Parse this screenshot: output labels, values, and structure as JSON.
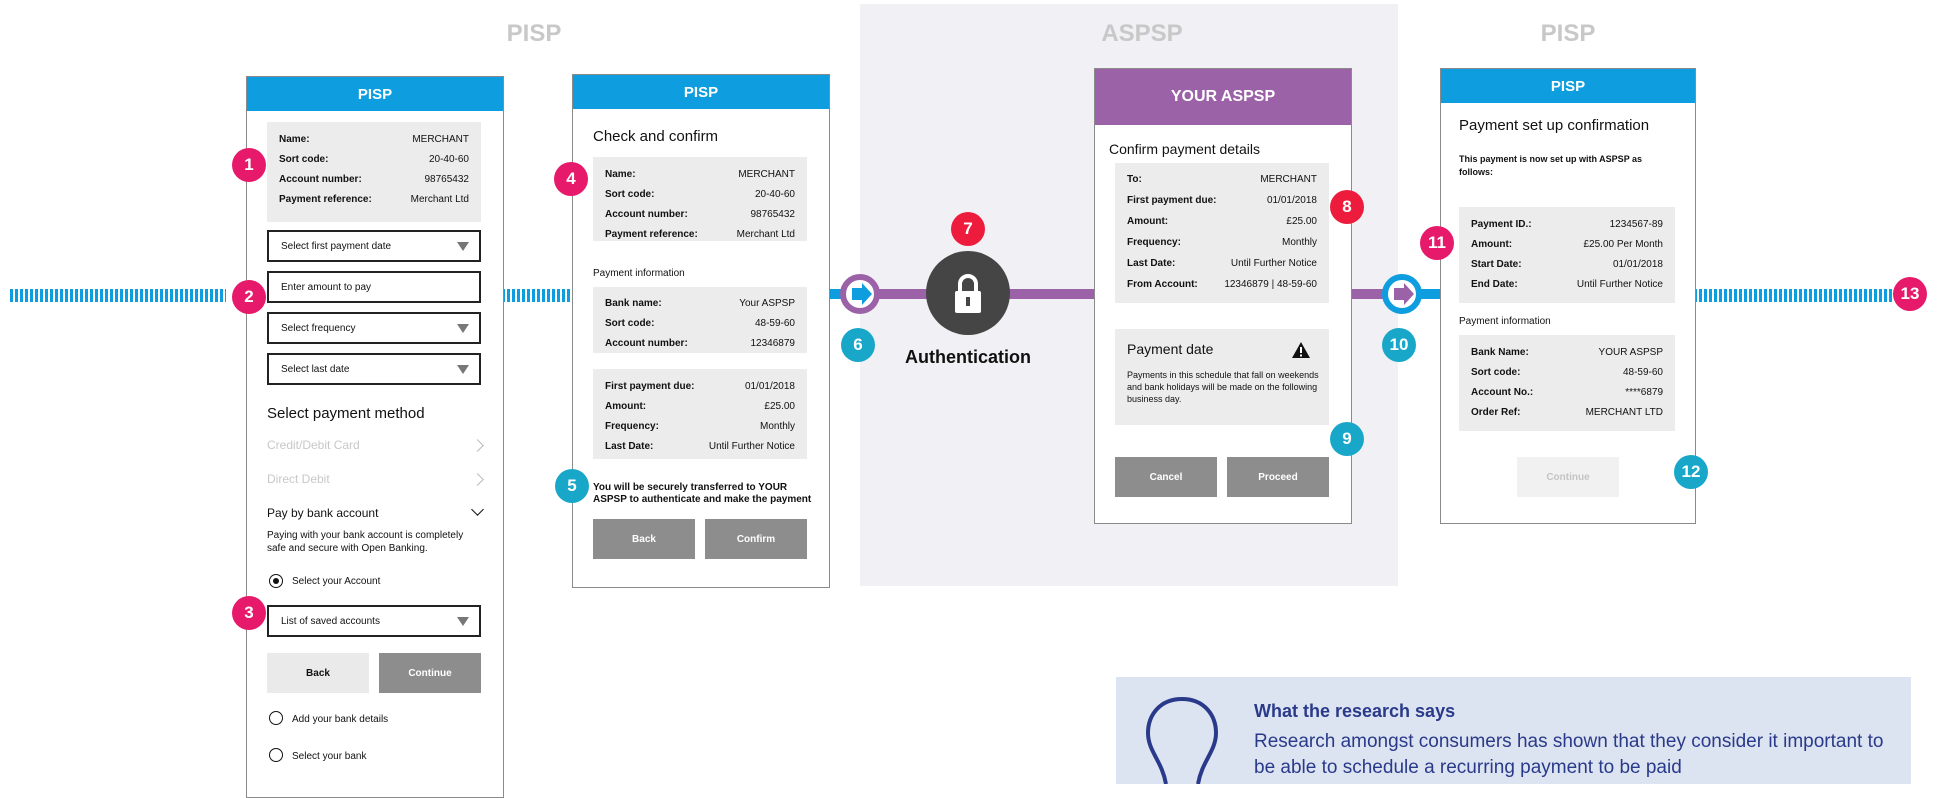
{
  "zones": {
    "pisp_left": "PISP",
    "aspsp": "ASPSP",
    "pisp_right": "PISP"
  },
  "colors": {
    "pisp_blue": "#0e9ee0",
    "aspsp_purple": "#9b62a8",
    "badge_pink": "#e6196b",
    "badge_teal": "#18a7c9",
    "badge_red": "#ee1c3c"
  },
  "screen1": {
    "header": "PISP",
    "details": [
      {
        "k": "Name:",
        "v": "MERCHANT"
      },
      {
        "k": "Sort code:",
        "v": "20-40-60"
      },
      {
        "k": "Account number:",
        "v": "98765432"
      },
      {
        "k": "Payment reference:",
        "v": "Merchant Ltd"
      }
    ],
    "select_first_date": "Select first payment date",
    "amount_placeholder": "Enter amount to pay",
    "select_frequency": "Select frequency",
    "select_last_date": "Select last date",
    "method_heading": "Select payment method",
    "method_card": "Credit/Debit Card",
    "method_dd": "Direct Debit",
    "method_bank": "Pay by bank account",
    "bank_desc": "Paying with your bank account is completely safe and secure with Open Banking.",
    "select_account": "Select your Account",
    "saved_accounts": "List of saved accounts",
    "back": "Back",
    "continue": "Continue",
    "add_bank": "Add your bank details",
    "select_bank": "Select your bank"
  },
  "screen2": {
    "header": "PISP",
    "title": "Check and confirm",
    "details": [
      {
        "k": "Name:",
        "v": "MERCHANT"
      },
      {
        "k": "Sort code:",
        "v": "20-40-60"
      },
      {
        "k": "Account number:",
        "v": "98765432"
      },
      {
        "k": "Payment reference:",
        "v": "Merchant Ltd"
      }
    ],
    "payment_info": "Payment information",
    "bank": [
      {
        "k": "Bank name:",
        "v": "Your ASPSP"
      },
      {
        "k": "Sort code:",
        "v": "48-59-60"
      },
      {
        "k": "Account number:",
        "v": "12346879"
      }
    ],
    "schedule": [
      {
        "k": "First payment due:",
        "v": "01/01/2018"
      },
      {
        "k": "Amount:",
        "v": "£25.00"
      },
      {
        "k": "Frequency:",
        "v": "Monthly"
      },
      {
        "k": "Last Date:",
        "v": "Until Further Notice"
      }
    ],
    "transfer_note": "You will be securely transferred to YOUR ASPSP to authenticate and make the payment",
    "back": "Back",
    "confirm": "Confirm"
  },
  "auth": {
    "label": "Authentication"
  },
  "screen3": {
    "header": "YOUR ASPSP",
    "title": "Confirm payment details",
    "details": [
      {
        "k": "To:",
        "v": "MERCHANT"
      },
      {
        "k": "First payment due:",
        "v": "01/01/2018"
      },
      {
        "k": "Amount:",
        "v": "£25.00"
      },
      {
        "k": "Frequency:",
        "v": "Monthly"
      },
      {
        "k": "Last Date:",
        "v": "Until Further Notice"
      },
      {
        "k": "From Account:",
        "v": "12346879 | 48-59-60"
      }
    ],
    "date_title": "Payment date",
    "date_text": "Payments in this schedule that fall on weekends and bank holidays will be made on the following business day.",
    "cancel": "Cancel",
    "proceed": "Proceed"
  },
  "screen4": {
    "header": "PISP",
    "title": "Payment set up confirmation",
    "subtitle": "This payment is now set up with ASPSP as follows:",
    "details": [
      {
        "k": "Payment ID.:",
        "v": "1234567-89"
      },
      {
        "k": "Amount:",
        "v": "£25.00 Per Month"
      },
      {
        "k": "Start Date:",
        "v": "01/01/2018"
      },
      {
        "k": "End Date:",
        "v": "Until Further Notice"
      }
    ],
    "payment_info": "Payment information",
    "bank": [
      {
        "k": "Bank Name:",
        "v": "YOUR ASPSP"
      },
      {
        "k": "Sort code:",
        "v": "48-59-60"
      },
      {
        "k": "Account No.:",
        "v": "****6879"
      },
      {
        "k": "Order Ref:",
        "v": "MERCHANT LTD"
      }
    ],
    "continue": "Continue"
  },
  "badges": {
    "b1": "1",
    "b2": "2",
    "b3": "3",
    "b4": "4",
    "b5": "5",
    "b6": "6",
    "b7": "7",
    "b8": "8",
    "b9": "9",
    "b10": "10",
    "b11": "11",
    "b12": "12",
    "b13": "13"
  },
  "research": {
    "title": "What the research says",
    "body": "Research amongst consumers has shown that they consider it important to be able to schedule a recurring payment to be paid"
  }
}
